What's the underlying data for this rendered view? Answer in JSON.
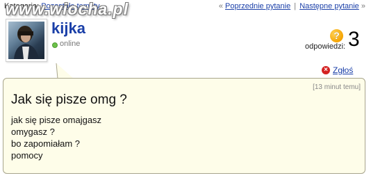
{
  "header": {
    "category_label": "Kategoria:",
    "category_link": "Pozostałe tematy",
    "prev_link": "Poprzednie pytanie",
    "next_link": "Następne pytanie",
    "prev_arrows": "«",
    "next_arrows": "»",
    "separator": "|"
  },
  "watermark": "www.wiocha.pl",
  "user": {
    "name": "kijka",
    "status": "online",
    "avatar_icon": "user-photo"
  },
  "answers": {
    "icon_glyph": "?",
    "label": "odpowiedzi:",
    "count": "3"
  },
  "report": {
    "icon_glyph": "×",
    "label": "Zgłoś"
  },
  "question": {
    "timestamp": "[13 minut temu]",
    "title": "Jak się pisze omg ?",
    "lines": [
      "jak się pisze omajgasz",
      "omygasz ?",
      "bo zapomiałam ?",
      "pomocy"
    ]
  },
  "colors": {
    "link": "#1a3fa8",
    "bubble_bg": "#fefde9",
    "bubble_border": "#a7a48c",
    "online": "#6cc24a",
    "answers_icon": "#f5a300",
    "report_icon": "#d42222"
  }
}
